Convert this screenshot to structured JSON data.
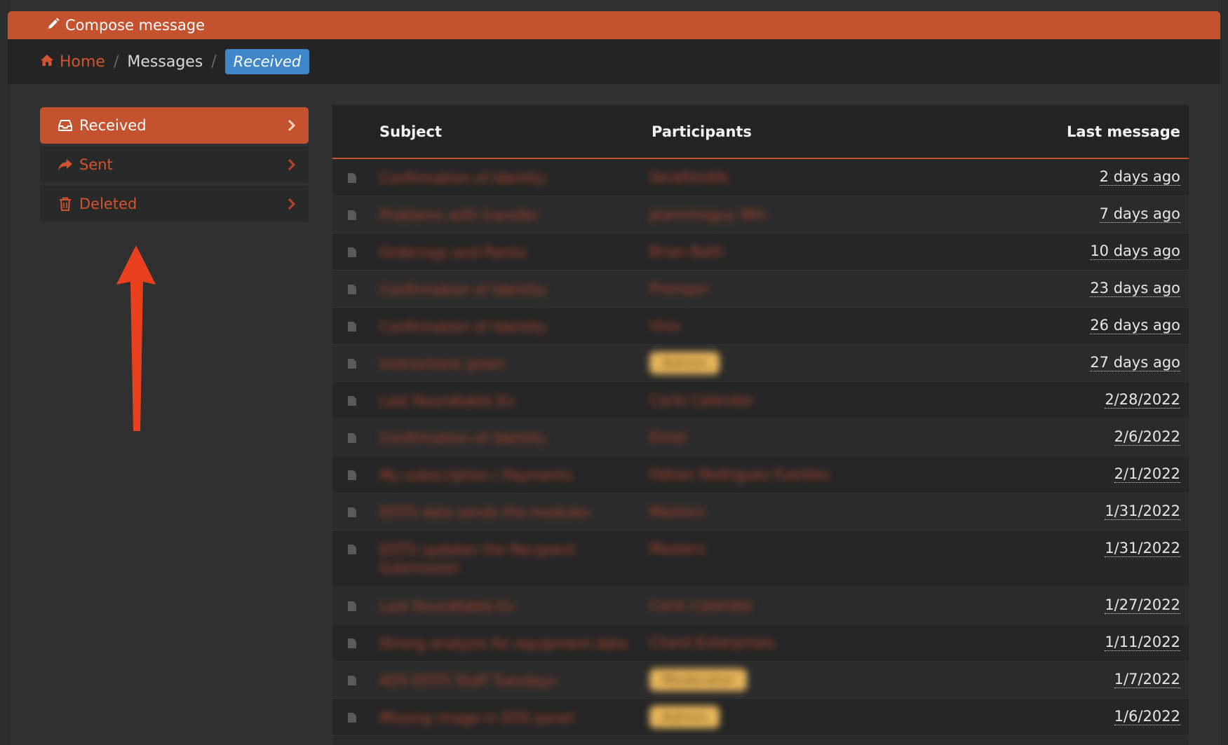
{
  "compose": {
    "label": "Compose message",
    "icon": "pencil-icon"
  },
  "breadcrumb": {
    "home": "Home",
    "messages": "Messages",
    "current": "Received"
  },
  "sidebar": {
    "items": [
      {
        "label": "Received",
        "icon": "inbox-icon",
        "active": true
      },
      {
        "label": "Sent",
        "icon": "share-icon",
        "active": false
      },
      {
        "label": "Deleted",
        "icon": "trash-icon",
        "active": false
      }
    ]
  },
  "table": {
    "headers": {
      "subject": "Subject",
      "participants": "Participants",
      "last": "Last message"
    },
    "rows": [
      {
        "subject": "Confirmation of Identity",
        "participant": "Serafimidik",
        "last": "2 days ago"
      },
      {
        "subject": "Problems with transfer",
        "participant": "jeanninoguy Win",
        "last": "7 days ago"
      },
      {
        "subject": "Orderings and Paints",
        "participant": "Brian Batti",
        "last": "10 days ago"
      },
      {
        "subject": "Confirmation of Identity",
        "participant": "Prempor",
        "last": "23 days ago"
      },
      {
        "subject": "Confirmation of Identity",
        "participant": "Vino",
        "last": "26 days ago"
      },
      {
        "subject": "Instructions given",
        "participant": "Admin",
        "last": "27 days ago",
        "badge": true
      },
      {
        "subject": "Last Roundtable Ex",
        "participant": "Carlo Calendar",
        "last": "2/28/2022"
      },
      {
        "subject": "Confirmation of Identity",
        "participant": "Elrod",
        "last": "2/6/2022"
      },
      {
        "subject": "My subscription / Payments",
        "participant": "Fabian Rodriguez Fuentes",
        "last": "2/1/2022"
      },
      {
        "subject": "EOTS data sends the modules",
        "participant": "Masters",
        "last": "1/31/2022"
      },
      {
        "subject": "EOTS updates the Recipient Submission",
        "participant": "Masters",
        "last": "1/31/2022",
        "tall": true
      },
      {
        "subject": "Last Roundtable Ex",
        "participant": "Carlo Calendar",
        "last": "1/27/2022"
      },
      {
        "subject": "Strong analysis for equipment data",
        "participant": "Chard Enterprises",
        "last": "1/11/2022"
      },
      {
        "subject": "ADS EOTS Staff Tuesdays",
        "participant": "Moderator",
        "last": "1/7/2022",
        "badge": true
      },
      {
        "subject": "Missing image in EOS panel",
        "participant": "Admin",
        "last": "1/6/2022",
        "badge": true
      }
    ]
  },
  "colors": {
    "accent": "#c4522f",
    "active_crumb": "#3f87c9",
    "annotation_arrow": "#e8401f"
  }
}
